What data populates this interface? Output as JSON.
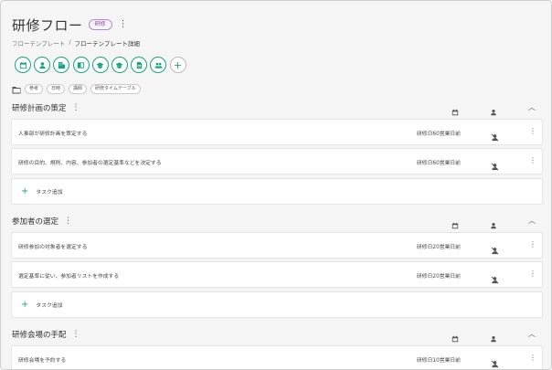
{
  "header": {
    "title": "研修フロー",
    "badge": "研修",
    "menu_glyph": "⋮"
  },
  "breadcrumb": {
    "parent": "フローテンプレート",
    "separator": "/",
    "current": "フローテンプレート詳細"
  },
  "toolbar_icons": [
    "calendar-icon",
    "person-icon",
    "building-icon",
    "book-icon",
    "graduation-cap-icon",
    "graduation-cap-icon",
    "document-icon",
    "group-icon",
    "add-icon"
  ],
  "accent_color": "#1aa383",
  "badge_color": "#8e44ad",
  "filters": {
    "chips": [
      "参考",
      "日時",
      "講師",
      "研修タイムテーブル"
    ]
  },
  "sections": [
    {
      "title": "研修計画の策定",
      "tasks": [
        {
          "name": "人事部が研修計画を策定する",
          "due": "研修日60営業日前"
        },
        {
          "name": "研修の目的、規則、内容、参加者の選定基準などを決定する",
          "due": "研修日60営業日前"
        }
      ],
      "add_label": "タスク追加"
    },
    {
      "title": "参加者の選定",
      "tasks": [
        {
          "name": "研修参加の対象者を選定する",
          "due": "研修日20営業日前"
        },
        {
          "name": "選定基準に従い、参加者リストを作成する",
          "due": "研修日20営業日前"
        }
      ],
      "add_label": "タスク追加"
    },
    {
      "title": "研修会場の手配",
      "tasks": [
        {
          "name": "研修会場を予約する",
          "due": "研修日10営業日前"
        }
      ]
    }
  ]
}
